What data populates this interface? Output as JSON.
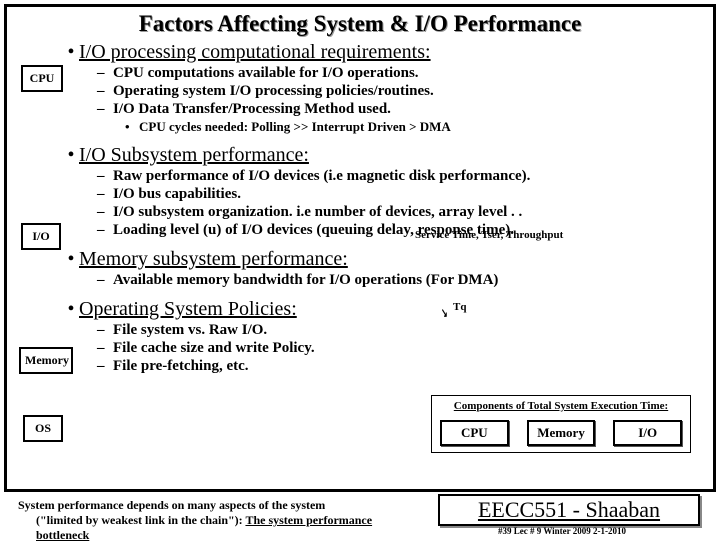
{
  "title": "Factors Affecting System & I/O Performance",
  "labels": {
    "cpu": "CPU",
    "io": "I/O",
    "memory": "Memory",
    "os": "OS"
  },
  "s1": {
    "head": "I/O processing computational requirements:",
    "a": "CPU computations available for I/O operations.",
    "b": "Operating system I/O processing policies/routines.",
    "c": "I/O Data Transfer/Processing Method used.",
    "d": "CPU cycles needed:   Polling  >>  Interrupt Driven  >  DMA"
  },
  "s2": {
    "head": "I/O Subsystem performance:",
    "a": "Raw performance of I/O devices (i.e magnetic disk performance).",
    "b": "I/O bus capabilities.",
    "c": "I/O subsystem organization.  i.e number of devices, array level . .",
    "d": "Loading level (u) of I/O devices (queuing delay, response time).",
    "note": "Service Time, Tser, Throughput"
  },
  "s3": {
    "head": "Memory subsystem performance:",
    "a": "Available memory bandwidth for I/O operations (For DMA)",
    "tq": "Tq"
  },
  "s4": {
    "head": "Operating System Policies:",
    "a": "File system vs. Raw I/O.",
    "b": "File cache size and write Policy.",
    "c": "File pre-fetching, etc."
  },
  "comp": {
    "title": "Components of Total System Execution Time:",
    "cpu": "CPU",
    "mem": "Memory",
    "io": "I/O"
  },
  "foot": {
    "l1": "System performance depends on many aspects of the system",
    "l2a": "(\"limited by weakest link in the chain\"):  ",
    "l2b": "The system performance bottleneck"
  },
  "course": "EECC551 - Shaaban",
  "meta": "#39   Lec # 9   Winter 2009  2-1-2010"
}
